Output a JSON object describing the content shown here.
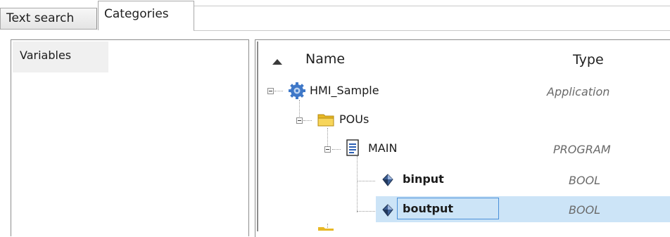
{
  "tabs": [
    {
      "label": "Text search",
      "active": false
    },
    {
      "label": "Categories",
      "active": true
    }
  ],
  "categories": {
    "items": [
      {
        "label": "Variables",
        "selected": true
      }
    ]
  },
  "table": {
    "columns": {
      "name": "Name",
      "type": "Type"
    },
    "sort": "ascending-by-name",
    "rows": [
      {
        "name": "HMI_Sample",
        "type": "Application",
        "icon": "gear-icon",
        "bold": false,
        "selected": false
      },
      {
        "name": "POUs",
        "type": "",
        "icon": "folder-icon",
        "bold": false,
        "selected": false
      },
      {
        "name": "MAIN",
        "type": "PROGRAM",
        "icon": "document-icon",
        "bold": false,
        "selected": false
      },
      {
        "name": "binput",
        "type": "BOOL",
        "icon": "variable-icon",
        "bold": true,
        "selected": false
      },
      {
        "name": "boutput",
        "type": "BOOL",
        "icon": "variable-icon",
        "bold": true,
        "selected": true
      }
    ]
  },
  "colors": {
    "selection": "#cce4f7",
    "focus": "#4a90d9",
    "gear": "#3f78c8",
    "folder": "#e8b825"
  }
}
